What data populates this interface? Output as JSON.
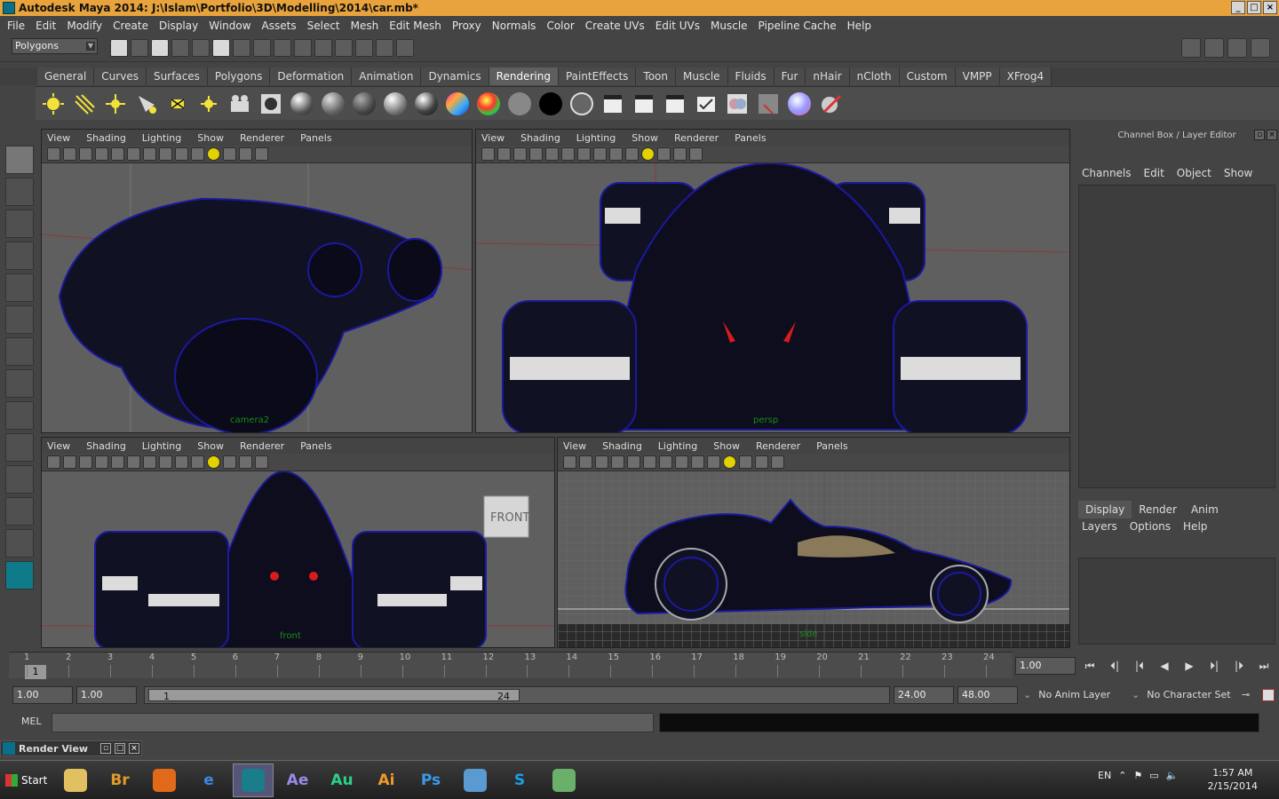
{
  "window": {
    "title": "Autodesk Maya 2014: J:\\Islam\\Portfolio\\3D\\Modelling\\2014\\car.mb*"
  },
  "menubar": [
    "File",
    "Edit",
    "Modify",
    "Create",
    "Display",
    "Window",
    "Assets",
    "Select",
    "Mesh",
    "Edit Mesh",
    "Proxy",
    "Normals",
    "Color",
    "Create UVs",
    "Edit UVs",
    "Muscle",
    "Pipeline Cache",
    "Help"
  ],
  "status": {
    "mode": "Polygons"
  },
  "shelf_tabs": [
    "General",
    "Curves",
    "Surfaces",
    "Polygons",
    "Deformation",
    "Animation",
    "Dynamics",
    "Rendering",
    "PaintEffects",
    "Toon",
    "Muscle",
    "Fluids",
    "Fur",
    "nHair",
    "nCloth",
    "Custom",
    "VMPP",
    "XFrog4"
  ],
  "shelf_active": "Rendering",
  "panel_menu": [
    "View",
    "Shading",
    "Lighting",
    "Show",
    "Renderer",
    "Panels"
  ],
  "viewports": {
    "top_left": {
      "camera": "camera2"
    },
    "top_right": {
      "camera": "persp"
    },
    "bottom_left": {
      "camera": "front",
      "viewcube": "FRONT"
    },
    "bottom_right": {
      "camera": "side"
    }
  },
  "channel_box": {
    "title": "Channel Box / Layer Editor",
    "menu": [
      "Channels",
      "Edit",
      "Object",
      "Show"
    ]
  },
  "layer_editor": {
    "tabs": [
      "Display",
      "Render",
      "Anim"
    ],
    "active_tab": "Display",
    "menu": [
      "Layers",
      "Options",
      "Help"
    ]
  },
  "timeline": {
    "ticks": [
      "1",
      "2",
      "3",
      "4",
      "5",
      "6",
      "7",
      "8",
      "9",
      "10",
      "11",
      "12",
      "13",
      "14",
      "15",
      "16",
      "17",
      "18",
      "19",
      "20",
      "21",
      "22",
      "23",
      "24"
    ],
    "current_frame": "1",
    "current_time_field": "1.00"
  },
  "range": {
    "start_time": "1.00",
    "playback_start": "1.00",
    "slider_start": "1",
    "slider_end": "24",
    "playback_end": "24.00",
    "end_time": "48.00",
    "anim_layer": "No Anim Layer",
    "character_set": "No Character Set"
  },
  "command_line": {
    "label": "MEL"
  },
  "render_view_bar": {
    "title": "Render View"
  },
  "taskbar": {
    "start": "Start",
    "apps": [
      {
        "name": "explorer",
        "label": "",
        "color": "#e0c060"
      },
      {
        "name": "bridge",
        "label": "Br",
        "color": "#e09a2a"
      },
      {
        "name": "firefox",
        "label": "",
        "color": "#e06a1a"
      },
      {
        "name": "ie",
        "label": "e",
        "color": "#3a8ae0"
      },
      {
        "name": "maya",
        "label": "",
        "color": "#1a7d8c"
      },
      {
        "name": "after-effects",
        "label": "Ae",
        "color": "#9a8ae8"
      },
      {
        "name": "audition",
        "label": "Au",
        "color": "#2ad08a"
      },
      {
        "name": "illustrator",
        "label": "Ai",
        "color": "#f09a2a"
      },
      {
        "name": "photoshop",
        "label": "Ps",
        "color": "#3a9ae8"
      },
      {
        "name": "rocket",
        "label": "",
        "color": "#5a9ad0"
      },
      {
        "name": "skype",
        "label": "S",
        "color": "#1aa0e8"
      },
      {
        "name": "monitor",
        "label": "",
        "color": "#6ab06a"
      }
    ],
    "lang": "EN",
    "time": "1:57 AM",
    "date": "2/15/2014"
  },
  "colors": {
    "accent_title": "#e8a33c",
    "wireframe": "#1a1aa0",
    "grid": "#8a8a8a"
  }
}
